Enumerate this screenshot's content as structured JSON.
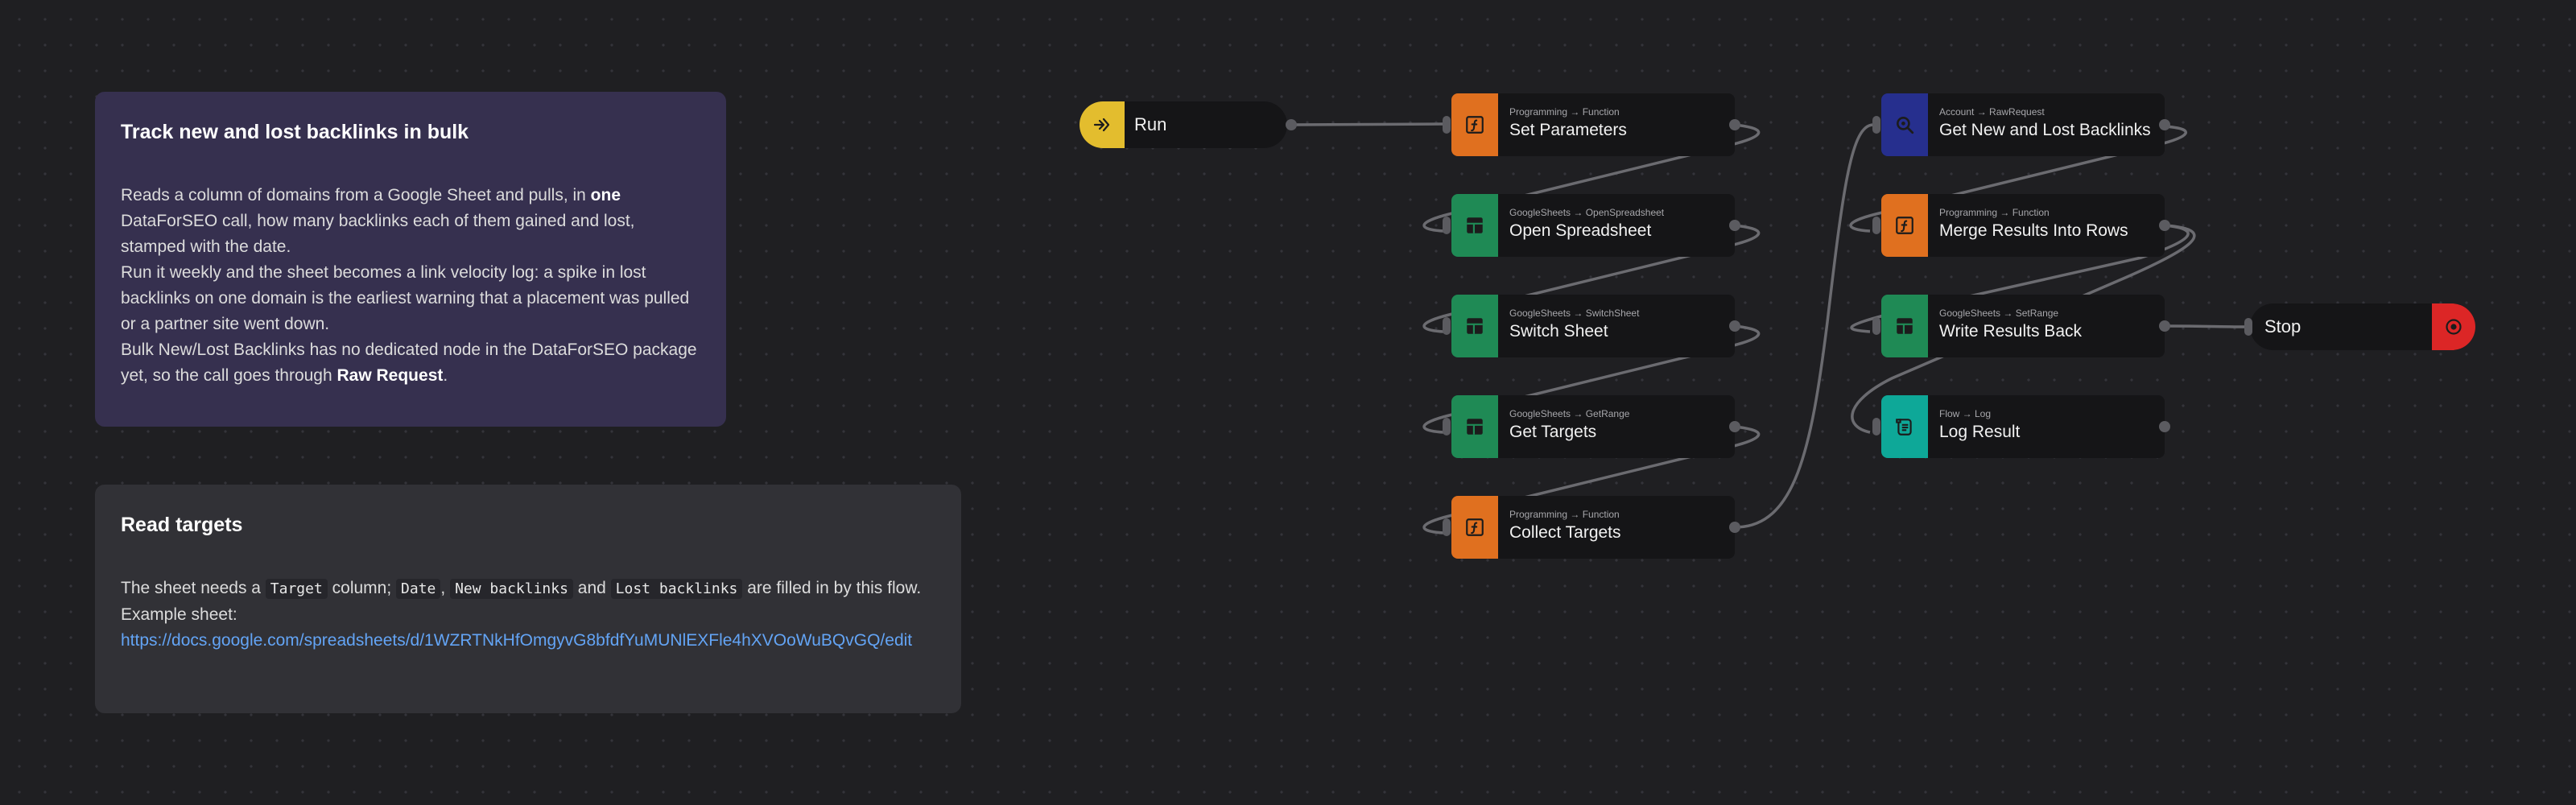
{
  "notes": {
    "intro": {
      "title": "Track new and lost backlinks in bulk",
      "p1_before": "Reads a column of domains from a Google Sheet and pulls, in ",
      "p1_bold": "one",
      "p1_after": " DataForSEO call, how many backlinks each of them gained and lost, stamped with the date.",
      "p2": "Run it weekly and the sheet becomes a link velocity log: a spike in lost backlinks on one domain is the earliest warning that a placement was pulled or a partner site went down.",
      "p3_before": "Bulk New/Lost Backlinks has no dedicated node in the DataForSEO package yet, so the call goes through ",
      "p3_bold": "Raw Request",
      "p3_after": "."
    },
    "targets": {
      "title": "Read targets",
      "t1": "The sheet needs a ",
      "code_target": "Target",
      "t2": " column; ",
      "code_date": "Date",
      "t3": ", ",
      "code_new": "New backlinks",
      "t4": " and ",
      "code_lost": "Lost backlinks",
      "t5": " are filled in by this flow.",
      "example_label": "Example sheet:",
      "link": "https://docs.google.com/spreadsheets/d/1WZRTNkHfOmgyvG8bfdfYuMUNlEXFle4hXVOoWuBQvGQ/edit"
    }
  },
  "colors": {
    "programming": "#e0701f",
    "googlesheets": "#1f8a55",
    "account": "#262f8e",
    "flow": "#0ea898",
    "run": "#e3bd2e",
    "stop": "#dc2626"
  },
  "nodes": {
    "run": {
      "title": "Run",
      "icon": "run-icon"
    },
    "set_parameters": {
      "sub": "Programming → Function",
      "title": "Set Parameters",
      "icon": "function-icon"
    },
    "open_spreadsheet": {
      "sub": "GoogleSheets → OpenSpreadsheet",
      "title": "Open Spreadsheet",
      "icon": "sheet-icon"
    },
    "switch_sheet": {
      "sub": "GoogleSheets → SwitchSheet",
      "title": "Switch Sheet",
      "icon": "sheet-icon"
    },
    "get_targets": {
      "sub": "GoogleSheets → GetRange",
      "title": "Get Targets",
      "icon": "sheet-icon"
    },
    "collect_targets": {
      "sub": "Programming → Function",
      "title": "Collect Targets",
      "icon": "function-icon"
    },
    "get_backlinks": {
      "sub": "Account → RawRequest",
      "title": "Get New and Lost Backlinks",
      "icon": "search-icon"
    },
    "merge_results": {
      "sub": "Programming → Function",
      "title": "Merge Results Into Rows",
      "icon": "function-icon"
    },
    "write_results": {
      "sub": "GoogleSheets → SetRange",
      "title": "Write Results Back",
      "icon": "sheet-icon"
    },
    "log_result": {
      "sub": "Flow → Log",
      "title": "Log Result",
      "icon": "log-icon"
    },
    "stop": {
      "title": "Stop",
      "icon": "stop-icon"
    }
  }
}
